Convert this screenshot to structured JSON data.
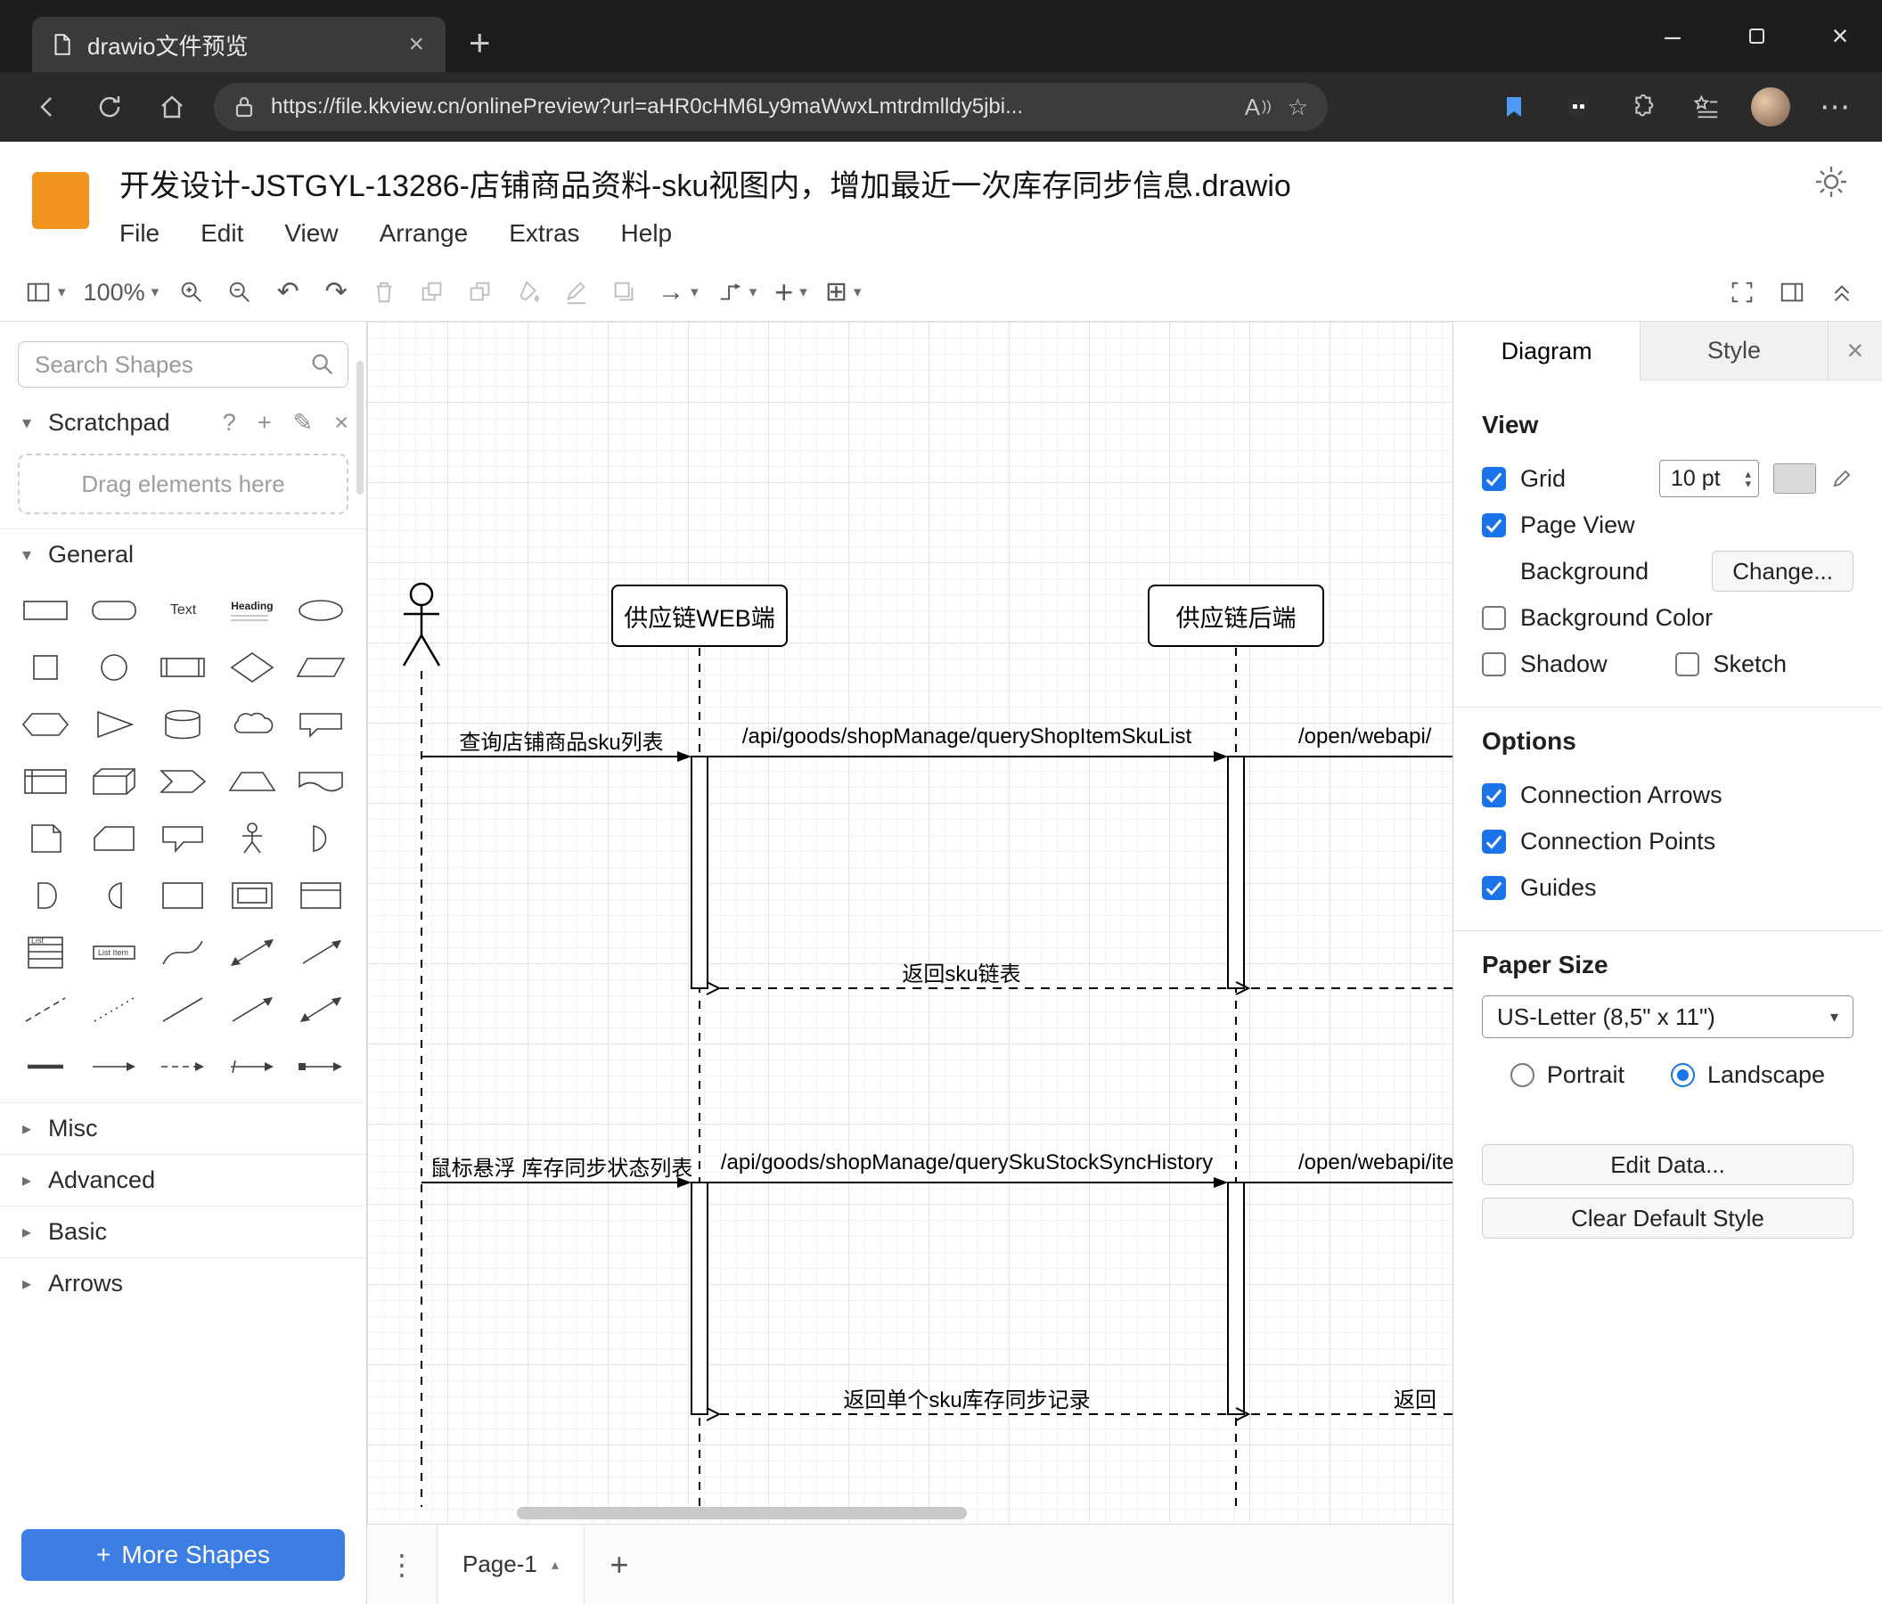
{
  "colors": {
    "accent_blue": "#1a73e8",
    "logo_orange": "#f2931e",
    "more_shapes_blue": "#3c7ee4",
    "grid_swatch": "#d9d9d9"
  },
  "icons": {
    "caret_down": "▾",
    "chevron_right": "▸",
    "chevron_up": "▴",
    "undo": "↶",
    "redo": "↷",
    "arrow_right": "→",
    "table": "⊞",
    "dots_vertical": "⋮",
    "dots_horizontal": "⋯",
    "close": "×",
    "plus": "+",
    "minus": "–",
    "star": "☆",
    "question": "?",
    "pencil": "✎",
    "read_aloud": "A"
  },
  "browser": {
    "tab_title": "drawio文件预览",
    "url": "https://file.kkview.cn/onlinePreview?url=aHR0cHM6Ly9maWwxLmtrdmlldy5jbi..."
  },
  "app": {
    "title": "开发设计-JSTGYL-13286-店铺商品资料-sku视图内，增加最近一次库存同步信息.drawio",
    "menus": [
      "File",
      "Edit",
      "View",
      "Arrange",
      "Extras",
      "Help"
    ],
    "zoom": "100%"
  },
  "sidebar": {
    "search_placeholder": "Search Shapes",
    "scratchpad_title": "Scratchpad",
    "drag_hint": "Drag elements here",
    "sections": [
      "General",
      "Misc",
      "Advanced",
      "Basic",
      "Arrows"
    ],
    "more_shapes": "More Shapes",
    "palette": [
      {
        "name": "rectangle"
      },
      {
        "name": "rounded-rectangle"
      },
      {
        "name": "text",
        "label": "Text"
      },
      {
        "name": "heading",
        "label": "Heading"
      },
      {
        "name": "ellipse"
      },
      {
        "name": "square"
      },
      {
        "name": "circle"
      },
      {
        "name": "process"
      },
      {
        "name": "diamond"
      },
      {
        "name": "parallelogram"
      },
      {
        "name": "hexagon"
      },
      {
        "name": "triangle"
      },
      {
        "name": "cylinder"
      },
      {
        "name": "cloud"
      },
      {
        "name": "callout-rect"
      },
      {
        "name": "internal-storage"
      },
      {
        "name": "cube"
      },
      {
        "name": "step"
      },
      {
        "name": "trapezoid"
      },
      {
        "name": "tape"
      },
      {
        "name": "note"
      },
      {
        "name": "card"
      },
      {
        "name": "callout"
      },
      {
        "name": "actor"
      },
      {
        "name": "or"
      },
      {
        "name": "and"
      },
      {
        "name": "data-storage"
      },
      {
        "name": "container"
      },
      {
        "name": "frame"
      },
      {
        "name": "titled-container"
      },
      {
        "name": "list",
        "label": "List"
      },
      {
        "name": "list-item",
        "label": "List Item"
      },
      {
        "name": "curve"
      },
      {
        "name": "bidirectional-arrow"
      },
      {
        "name": "arrow"
      },
      {
        "name": "dashed-line"
      },
      {
        "name": "dotted-line"
      },
      {
        "name": "line"
      },
      {
        "name": "arrow-diagonal"
      },
      {
        "name": "double-arrow-diagonal"
      },
      {
        "name": "bold-line"
      },
      {
        "name": "arrow-right"
      },
      {
        "name": "dashed-arrow-right"
      },
      {
        "name": "link"
      },
      {
        "name": "connector"
      }
    ]
  },
  "canvas": {
    "participants": [
      {
        "label": "供应链WEB端"
      },
      {
        "label": "供应链后端"
      }
    ],
    "messages": {
      "query_sku_list": "查询店铺商品sku列表",
      "api_query_sku_list": "/api/goods/shopManage/queryShopItemSkuList",
      "open_webapi_1": "/open/webapi/",
      "return_sku_list": "返回sku链表",
      "hover_sync_list": "鼠标悬浮 库存同步状态列表",
      "api_query_sync_history": "/api/goods/shopManage/querySkuStockSyncHistory",
      "open_webapi_2": "/open/webapi/item",
      "return_single_record": "返回单个sku库存同步记录",
      "return_partial": "返回"
    },
    "page_tab": "Page-1"
  },
  "format_panel": {
    "tabs": [
      "Diagram",
      "Style"
    ],
    "view": {
      "heading": "View",
      "grid_label": "Grid",
      "grid_size": "10 pt",
      "page_view_label": "Page View",
      "background_label": "Background",
      "change_button": "Change...",
      "background_color_label": "Background Color",
      "shadow_label": "Shadow",
      "sketch_label": "Sketch"
    },
    "options": {
      "heading": "Options",
      "connection_arrows": "Connection Arrows",
      "connection_points": "Connection Points",
      "guides": "Guides"
    },
    "paper": {
      "heading": "Paper Size",
      "size_value": "US-Letter (8,5\" x 11\")",
      "portrait": "Portrait",
      "landscape": "Landscape"
    },
    "edit_data_button": "Edit Data...",
    "clear_style_button": "Clear Default Style"
  }
}
